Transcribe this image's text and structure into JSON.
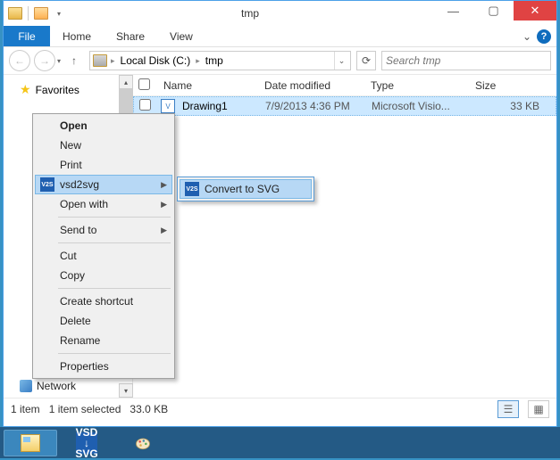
{
  "window": {
    "title": "tmp",
    "qat_dropdown": "▾"
  },
  "ribbon": {
    "file": "File",
    "tabs": [
      "Home",
      "Share",
      "View"
    ]
  },
  "nav": {
    "back": "←",
    "fwd": "→",
    "hist": "▾",
    "up": "↑",
    "refresh": "⟳",
    "crumbs": [
      "Local Disk (C:)",
      "tmp"
    ],
    "search_ph": "Search tmp"
  },
  "sidebar": {
    "favorites": "Favorites",
    "network": "Network"
  },
  "list": {
    "columns": {
      "name": "Name",
      "date": "Date modified",
      "type": "Type",
      "size": "Size"
    },
    "rows": [
      {
        "name": "Drawing1",
        "date": "7/9/2013 4:36 PM",
        "type": "Microsoft Visio...",
        "size": "33 KB"
      }
    ]
  },
  "status": {
    "count": "1 item",
    "selected": "1 item selected",
    "size": "33.0 KB"
  },
  "context_menu": {
    "open": "Open",
    "new": "New",
    "print": "Print",
    "vsd2svg": "vsd2svg",
    "open_with": "Open with",
    "send_to": "Send to",
    "cut": "Cut",
    "copy": "Copy",
    "shortcut": "Create shortcut",
    "delete": "Delete",
    "rename": "Rename",
    "properties": "Properties"
  },
  "submenu": {
    "convert": "Convert to SVG"
  },
  "taskbar": {
    "vsd": "VSD",
    "svg": "SVG",
    "arrow": "↓"
  }
}
